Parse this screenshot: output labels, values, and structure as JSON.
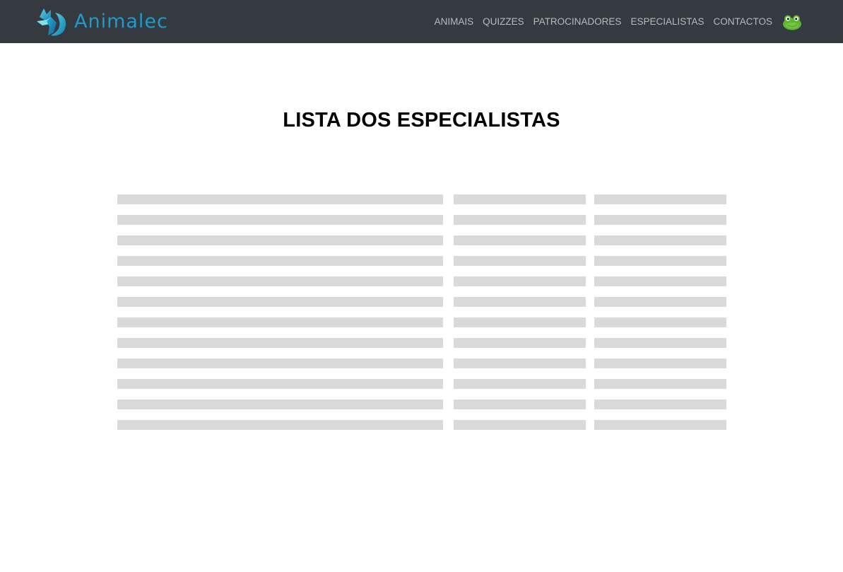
{
  "brand": {
    "name": "Animalec",
    "logo_icon": "fox-logo-icon",
    "color": "#1d9bc9"
  },
  "nav": {
    "items": [
      {
        "label": "ANIMAIS"
      },
      {
        "label": "QUIZZES"
      },
      {
        "label": "PATROCINADORES"
      },
      {
        "label": "ESPECIALISTAS"
      },
      {
        "label": "CONTACTOS"
      }
    ],
    "avatar_icon": "frog-avatar-icon",
    "background": "#343a40"
  },
  "page": {
    "title": "LISTA DOS ESPECIALISTAS"
  },
  "table": {
    "state": "loading-placeholder",
    "placeholder_color": "#dadada",
    "row_count": 12
  }
}
